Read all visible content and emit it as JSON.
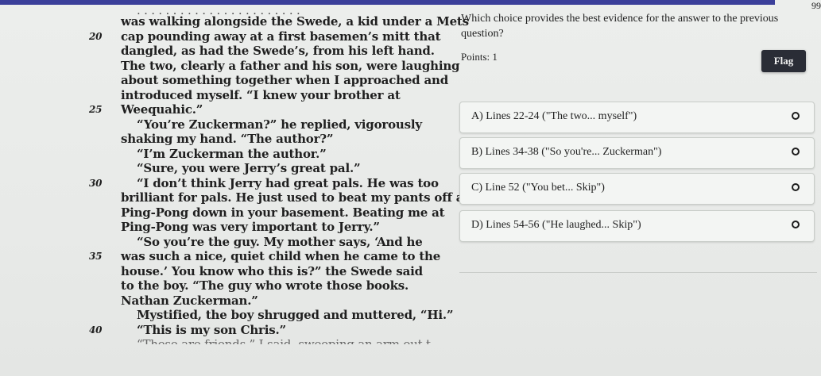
{
  "header": {
    "corner_number": "99"
  },
  "passage": {
    "lines": [
      {
        "num": "",
        "text": "was walking alongside the Swede, a kid under a Mets",
        "indent": false
      },
      {
        "num": "20",
        "text": "cap pounding away at a first basemen’s mitt that",
        "indent": false
      },
      {
        "num": "",
        "text": "dangled, as had the Swede’s, from his left hand.",
        "indent": false
      },
      {
        "num": "",
        "text": "The two, clearly a father and his son, were laughing",
        "indent": false
      },
      {
        "num": "",
        "text": "about something together when I approached and",
        "indent": false
      },
      {
        "num": "",
        "text": "introduced myself. “I knew your brother at",
        "indent": false
      },
      {
        "num": "25",
        "text": "Weequahic.”",
        "indent": false
      },
      {
        "num": "",
        "text": "“You’re Zuckerman?” he replied, vigorously",
        "indent": true
      },
      {
        "num": "",
        "text": "shaking my hand. “The author?”",
        "indent": false
      },
      {
        "num": "",
        "text": "“I’m Zuckerman the author.”",
        "indent": true
      },
      {
        "num": "",
        "text": "“Sure, you were Jerry’s great pal.”",
        "indent": true
      },
      {
        "num": "30",
        "text": "“I don’t think Jerry had great pals. He was too",
        "indent": true
      },
      {
        "num": "",
        "text": "brilliant for pals. He just used to beat my pants off at",
        "indent": false
      },
      {
        "num": "",
        "text": "Ping-Pong down in your basement. Beating me at",
        "indent": false
      },
      {
        "num": "",
        "text": "Ping-Pong was very important to Jerry.”",
        "indent": false
      },
      {
        "num": "",
        "text": "“So you’re the guy. My mother says, ‘And he",
        "indent": true
      },
      {
        "num": "35",
        "text": "was such a nice, quiet child when he came to the",
        "indent": false
      },
      {
        "num": "",
        "text": "house.’ You know who this is?” the Swede said",
        "indent": false
      },
      {
        "num": "",
        "text": "to the boy. “The guy who wrote those books.",
        "indent": false
      },
      {
        "num": "",
        "text": "Nathan Zuckerman.”",
        "indent": false
      },
      {
        "num": "",
        "text": "Mystified, the boy shrugged and muttered, “Hi.”",
        "indent": true
      },
      {
        "num": "40",
        "text": "“This is my son Chris.”",
        "indent": true
      },
      {
        "num": "",
        "text": "“These are friends,” I said, sweeping an arm out to",
        "indent": true
      }
    ]
  },
  "question": {
    "prompt": "Which choice provides the best evidence for the answer to the previous question?",
    "points": "Points: 1",
    "flag_label": "Flag",
    "choices": [
      {
        "label": "A) Lines 22-24 (\"The two... myself\")"
      },
      {
        "label": "B) Lines 34-38 (\"So you're... Zuckerman\")"
      },
      {
        "label": "C) Line 52 (\"You bet... Skip\")"
      },
      {
        "label": "D) Lines 54-56 (\"He laughed... Skip\")"
      }
    ]
  },
  "colors": {
    "top_bar": "#3b3f9a",
    "flag_button": "#2a2d36"
  }
}
